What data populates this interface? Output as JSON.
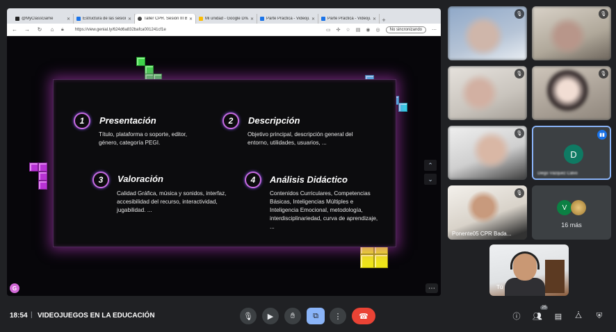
{
  "browser": {
    "tabs": [
      {
        "label": "@MyClassGame",
        "active": false
      },
      {
        "label": "Estructura de las sesiones",
        "active": false
      },
      {
        "label": "Taller CPR. Sesión III BADA",
        "active": true
      },
      {
        "label": "Mi unidad - Google Drive",
        "active": false
      },
      {
        "label": "Parte Práctica - Videojue",
        "active": false
      },
      {
        "label": "Parte Práctica - Videojue",
        "active": false
      }
    ],
    "url": "https://view.genial.ly/624d6a832bafca001241cf1e",
    "sync_label": "No sincronizando"
  },
  "slide": {
    "items": [
      {
        "number": "1",
        "title": "Presentación",
        "description": "Título, plataforma o soporte, editor, género, categoría PEGI."
      },
      {
        "number": "2",
        "title": "Descripción",
        "description": "Objetivo principal, descripción general del entorno, utilidades, usuarios, ..."
      },
      {
        "number": "3",
        "title": "Valoración",
        "description": "Calidad Gráfica, música y sonidos, interfaz, accesibilidad del recurso, interactividad, jugabilidad. ..."
      },
      {
        "number": "4",
        "title": "Análisis Didáctico",
        "description": "Contenidos Curriculares, Competencias Básicas, Inteligencias Múltiples e Inteligencia Emocional, metodología, interdisciplinariedad, curva de aprendizaje, ..."
      }
    ],
    "logo_letter": "G"
  },
  "participants": {
    "tiles": [
      {
        "name": "",
        "muted": true
      },
      {
        "name": "",
        "muted": true
      },
      {
        "name": "",
        "muted": true
      },
      {
        "name": "",
        "muted": true
      },
      {
        "name": "",
        "muted": true
      },
      {
        "name": "Diego Vázquez Calvo",
        "avatar_letter": "D",
        "speaking": true
      },
      {
        "name": "Ponente05 CPR Bada...",
        "muted": true
      }
    ],
    "more": {
      "label": "16 más",
      "avatar_letters": [
        "V",
        ""
      ]
    },
    "self_label": "Tú"
  },
  "meeting": {
    "time": "18:54",
    "title": "VIDEOJUEGOS EN LA EDUCACIÓN",
    "people_count": "25"
  },
  "colors": {
    "accent_blue": "#8ab4f8",
    "hangup_red": "#ea4335",
    "glow_purple": "#c86be0"
  }
}
